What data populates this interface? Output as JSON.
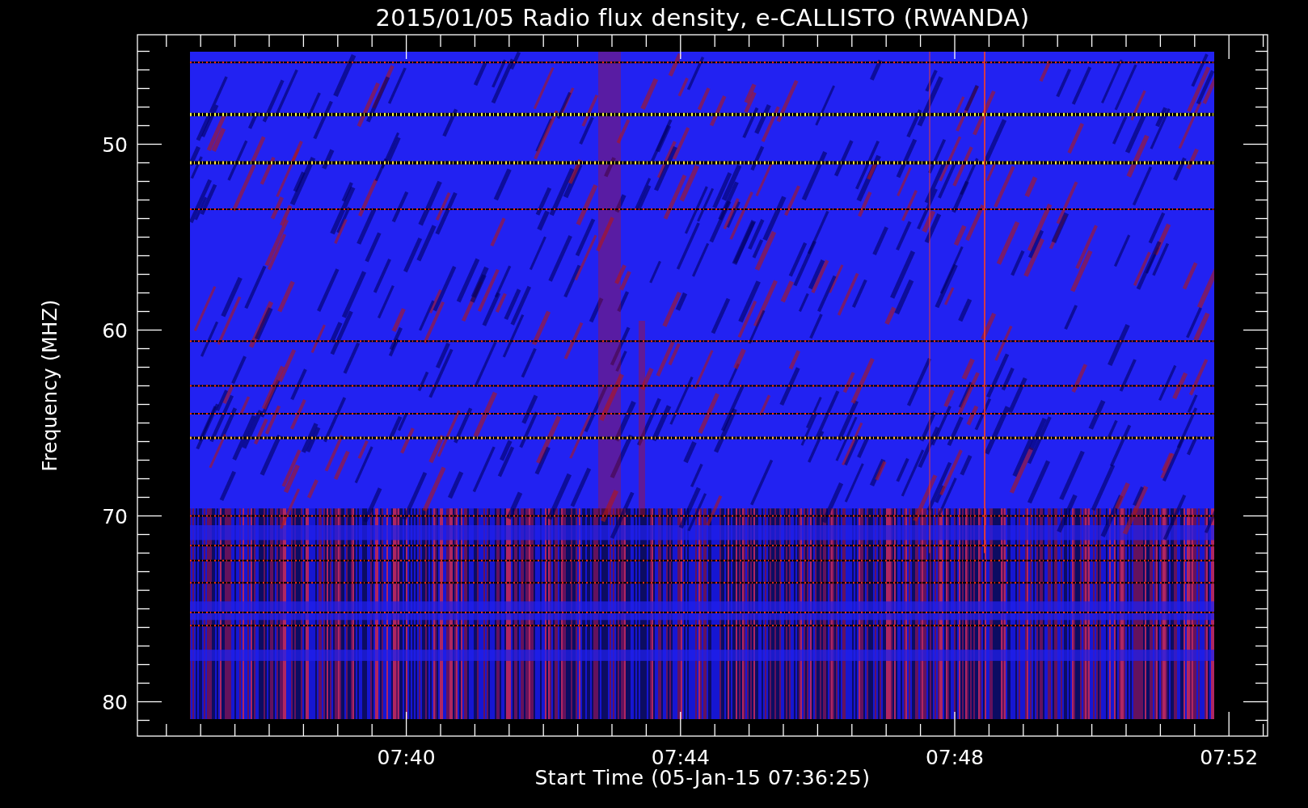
{
  "plot": {
    "title": "2015/01/05  Radio flux density, e-CALLISTO (RWANDA)",
    "ylabel": "Frequency (MHZ)",
    "xlabel": "Start Time (05-Jan-15 07:36:25)",
    "yticks": [
      "50",
      "60",
      "70",
      "80"
    ],
    "xticks": [
      "07:40",
      "07:44",
      "07:48",
      "07:52"
    ]
  }
}
